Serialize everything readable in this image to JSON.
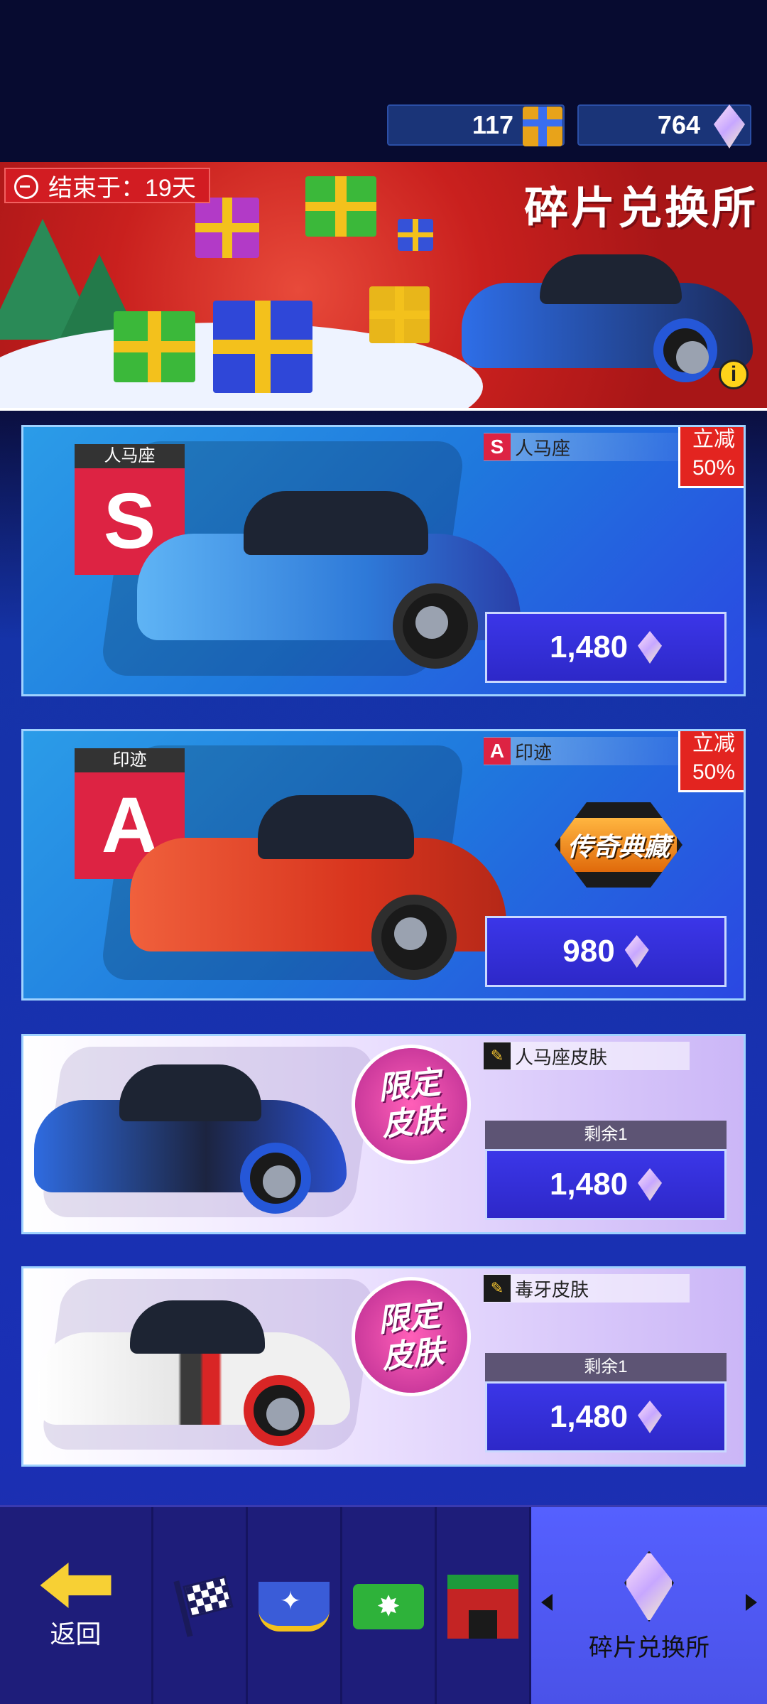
{
  "currencies": {
    "gifts": "117",
    "gems": "764"
  },
  "banner": {
    "timer": "结束于：19天",
    "title": "碎片兑换所"
  },
  "offers": [
    {
      "rank_name": "人马座",
      "rank_letter": "S",
      "label_badge": "S",
      "car_name": "人马座",
      "discount_line1": "立减",
      "discount_line2": "50%",
      "price": "1,480",
      "accent": "#2f8ff0"
    },
    {
      "rank_name": "印迹",
      "rank_letter": "A",
      "label_badge": "A",
      "car_name": "印迹",
      "discount_line1": "立减",
      "discount_line2": "50%",
      "price": "980",
      "badge": "传奇典藏",
      "accent": "#e2452a"
    },
    {
      "car_name": "人马座皮肤",
      "badge_line1": "限定",
      "badge_line2": "皮肤",
      "remaining": "剩余1",
      "price": "1,480"
    },
    {
      "car_name": "毒牙皮肤",
      "badge_line1": "限定",
      "badge_line2": "皮肤",
      "remaining": "剩余1",
      "price": "1,480"
    }
  ],
  "nav": {
    "back_label": "返回",
    "active_label": "碎片兑换所"
  }
}
